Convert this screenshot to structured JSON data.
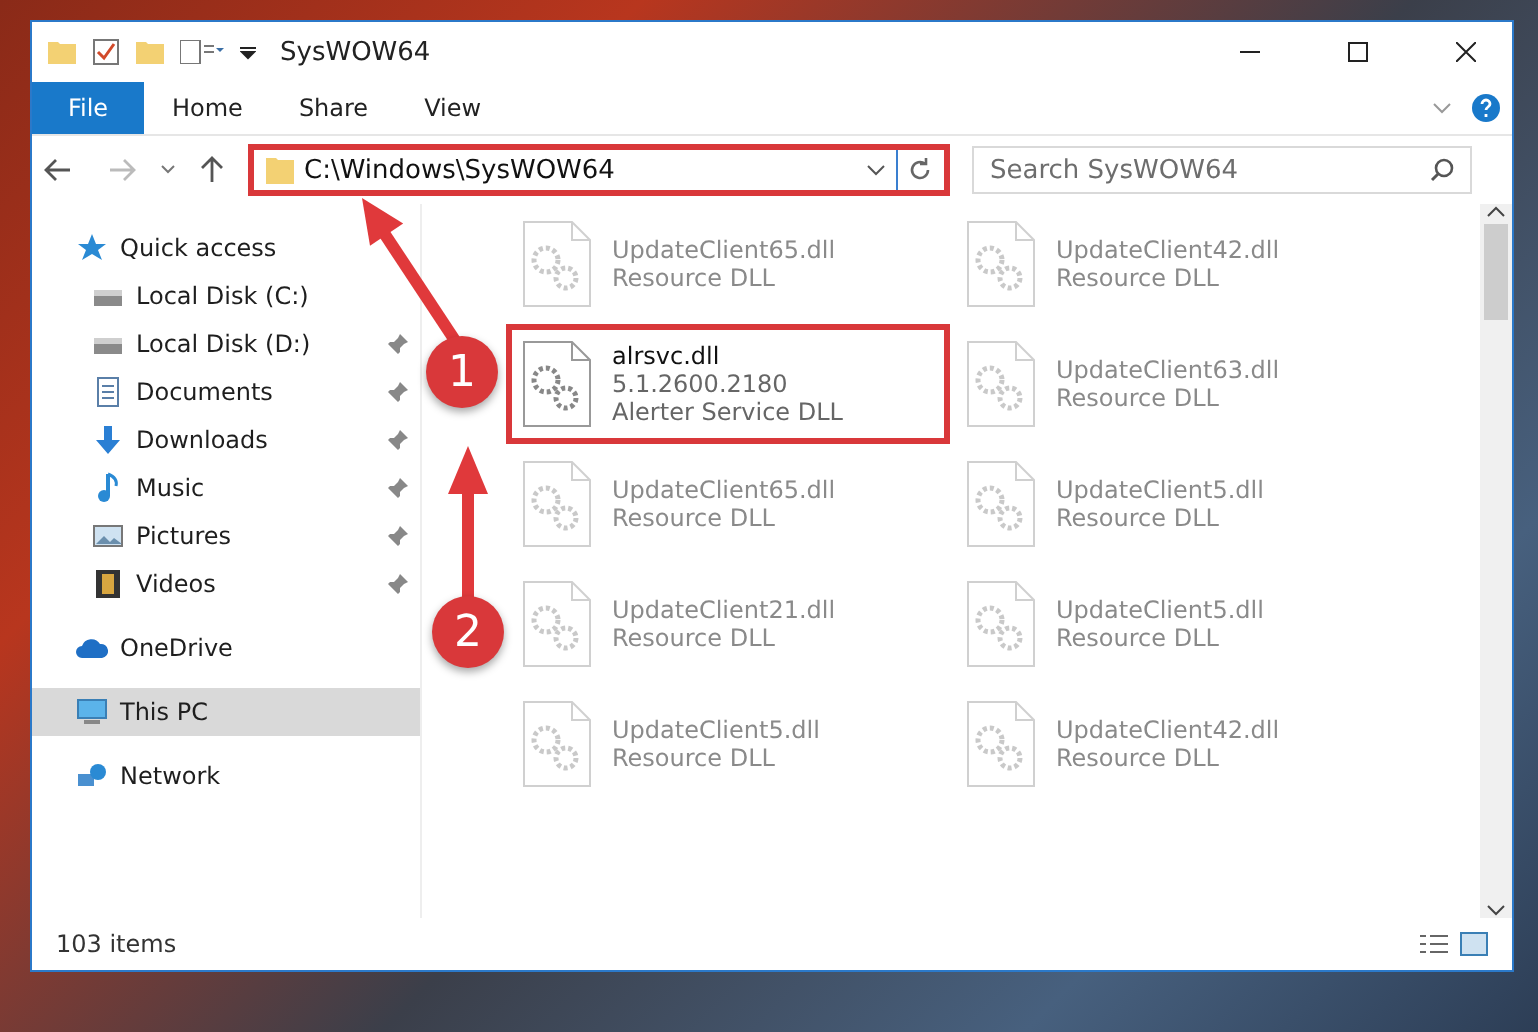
{
  "window": {
    "title": "SysWOW64"
  },
  "ribbon": {
    "tabs": [
      {
        "label": "File",
        "kind": "file"
      },
      {
        "label": "Home",
        "kind": "tab"
      },
      {
        "label": "Share",
        "kind": "tab"
      },
      {
        "label": "View",
        "kind": "tab"
      }
    ]
  },
  "address": {
    "path": "C:\\Windows\\SysWOW64",
    "highlighted": true
  },
  "search": {
    "placeholder": "Search SysWOW64"
  },
  "sidebar": {
    "items": [
      {
        "label": "Quick access",
        "kind": "star",
        "selected": false,
        "children": [
          {
            "label": "Local Disk (C:)",
            "kind": "drive",
            "pinned": false
          },
          {
            "label": "Local Disk (D:)",
            "kind": "drive",
            "pinned": true
          },
          {
            "label": "Documents",
            "kind": "document",
            "pinned": true
          },
          {
            "label": "Downloads",
            "kind": "download",
            "pinned": true
          },
          {
            "label": "Music",
            "kind": "music",
            "pinned": true
          },
          {
            "label": "Pictures",
            "kind": "picture",
            "pinned": true
          },
          {
            "label": "Videos",
            "kind": "video",
            "pinned": true
          }
        ]
      },
      {
        "label": "OneDrive",
        "kind": "cloud",
        "selected": false
      },
      {
        "label": "This PC",
        "kind": "pc",
        "selected": true
      },
      {
        "label": "Network",
        "kind": "network",
        "selected": false
      }
    ]
  },
  "files": [
    {
      "name": "UpdateClient65.dll",
      "description": "Resource DLL",
      "faded": true,
      "highlighted": false
    },
    {
      "name": "UpdateClient42.dll",
      "description": "Resource DLL",
      "faded": true,
      "highlighted": false
    },
    {
      "name": "alrsvc.dll",
      "version": "5.1.2600.2180",
      "description": "Alerter Service DLL",
      "faded": false,
      "highlighted": true
    },
    {
      "name": "UpdateClient63.dll",
      "description": "Resource DLL",
      "faded": true,
      "highlighted": false
    },
    {
      "name": "UpdateClient65.dll",
      "description": "Resource DLL",
      "faded": true,
      "highlighted": false
    },
    {
      "name": "UpdateClient5.dll",
      "description": "Resource DLL",
      "faded": true,
      "highlighted": false
    },
    {
      "name": "UpdateClient21.dll",
      "description": "Resource DLL",
      "faded": true,
      "highlighted": false
    },
    {
      "name": "UpdateClient5.dll",
      "description": "Resource DLL",
      "faded": true,
      "highlighted": false
    },
    {
      "name": "UpdateClient5.dll",
      "description": "Resource DLL",
      "faded": true,
      "highlighted": false
    },
    {
      "name": "UpdateClient42.dll",
      "description": "Resource DLL",
      "faded": true,
      "highlighted": false
    }
  ],
  "status_bar": {
    "count": "103 items"
  },
  "annotations": [
    {
      "number": "1"
    },
    {
      "number": "2"
    }
  ]
}
